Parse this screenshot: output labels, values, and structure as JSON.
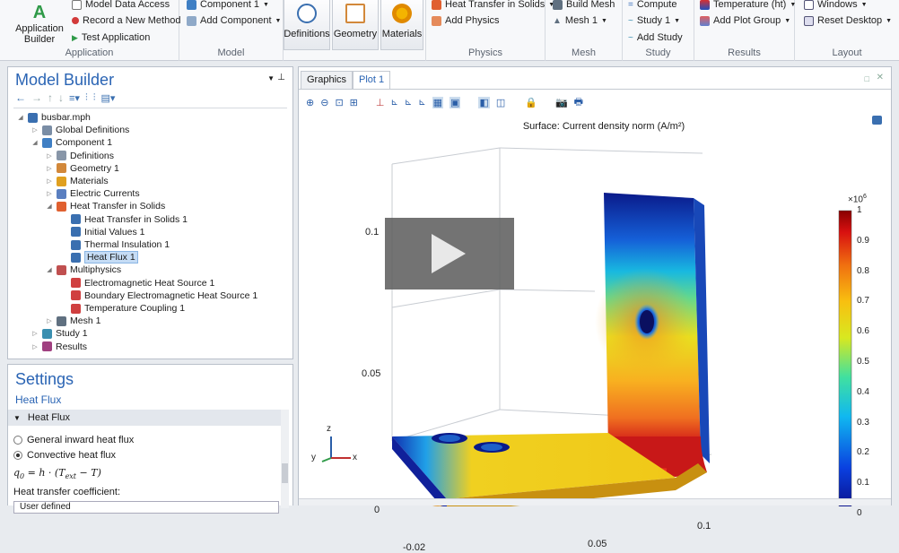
{
  "ribbon": {
    "application": {
      "big": "Application Builder",
      "items": [
        "Model Data Access",
        "Record a New Method",
        "Test Application"
      ],
      "label": "Application"
    },
    "model": {
      "items": [
        "Component 1",
        "Add Component"
      ],
      "label": "Model"
    },
    "definitions": "Definitions",
    "geometry": "Geometry",
    "materials": "Materials",
    "physics": {
      "items": [
        "Heat Transfer in Solids",
        "Add Physics"
      ],
      "label": "Physics"
    },
    "mesh": {
      "items": [
        "Build Mesh",
        "Mesh 1"
      ],
      "label": "Mesh"
    },
    "study": {
      "items": [
        "Compute",
        "Study 1",
        "Add Study"
      ],
      "label": "Study"
    },
    "results": {
      "items": [
        "Temperature (ht)",
        "Add Plot Group"
      ],
      "label": "Results"
    },
    "layout": {
      "items": [
        "Windows",
        "Reset Desktop"
      ],
      "label": "Layout"
    }
  },
  "model_builder": {
    "title": "Model Builder",
    "tree": [
      {
        "label": "busbar.mph",
        "level": 0,
        "exp": "down",
        "color": "#3a6fb0"
      },
      {
        "label": "Global Definitions",
        "level": 1,
        "exp": "right",
        "color": "#7a8da5"
      },
      {
        "label": "Component 1",
        "level": 1,
        "exp": "down",
        "color": "#3f7fc4"
      },
      {
        "label": "Definitions",
        "level": 2,
        "exp": "right",
        "color": "#8896a8"
      },
      {
        "label": "Geometry 1",
        "level": 2,
        "exp": "right",
        "color": "#d2883a"
      },
      {
        "label": "Materials",
        "level": 2,
        "exp": "right",
        "color": "#e0a020"
      },
      {
        "label": "Electric Currents",
        "level": 2,
        "exp": "right",
        "color": "#5a7fc0"
      },
      {
        "label": "Heat Transfer in Solids",
        "level": 2,
        "exp": "down",
        "color": "#e06030"
      },
      {
        "label": "Heat Transfer in Solids 1",
        "level": 3,
        "exp": "",
        "color": "#3a6fb0"
      },
      {
        "label": "Initial Values 1",
        "level": 3,
        "exp": "",
        "color": "#3a6fb0"
      },
      {
        "label": "Thermal Insulation 1",
        "level": 3,
        "exp": "",
        "color": "#3a6fb0"
      },
      {
        "label": "Heat Flux 1",
        "level": 3,
        "exp": "",
        "color": "#3a6fb0",
        "selected": true
      },
      {
        "label": "Multiphysics",
        "level": 2,
        "exp": "down",
        "color": "#c05050"
      },
      {
        "label": "Electromagnetic Heat Source 1",
        "level": 3,
        "exp": "",
        "color": "#d04040"
      },
      {
        "label": "Boundary Electromagnetic Heat Source 1",
        "level": 3,
        "exp": "",
        "color": "#d04040"
      },
      {
        "label": "Temperature Coupling 1",
        "level": 3,
        "exp": "",
        "color": "#d04040"
      },
      {
        "label": "Mesh 1",
        "level": 2,
        "exp": "right",
        "color": "#607080"
      },
      {
        "label": "Study 1",
        "level": 1,
        "exp": "right",
        "color": "#3a8fb0"
      },
      {
        "label": "Results",
        "level": 1,
        "exp": "right",
        "color": "#a04080"
      }
    ]
  },
  "settings": {
    "title": "Settings",
    "subtitle": "Heat Flux",
    "section": "Heat Flux",
    "options": [
      "General inward heat flux",
      "Convective heat flux"
    ],
    "eq_q": "q",
    "eq_sub": "0",
    "eq_rest": "= h · (T",
    "eq_ext": "ext",
    "eq_tail": " − T)",
    "htc_label": "Heat transfer coefficient:",
    "htc_value": "User defined"
  },
  "graphics": {
    "tabs": [
      "Graphics",
      "Plot 1"
    ],
    "plot_title": "Surface: Current density norm (A/m²)",
    "z_ticks": [
      "0.1",
      "0.05",
      "0"
    ],
    "x_ticks": [
      "-0.02",
      "0.05",
      "0.1"
    ],
    "colorbar": {
      "exponent": "×10",
      "exp_power": "6",
      "ticks": [
        "1",
        "0.9",
        "0.8",
        "0.7",
        "0.6",
        "0.5",
        "0.4",
        "0.3",
        "0.2",
        "0.1",
        "0"
      ]
    },
    "axis": {
      "z": "z",
      "y": "y",
      "x": "x"
    }
  }
}
